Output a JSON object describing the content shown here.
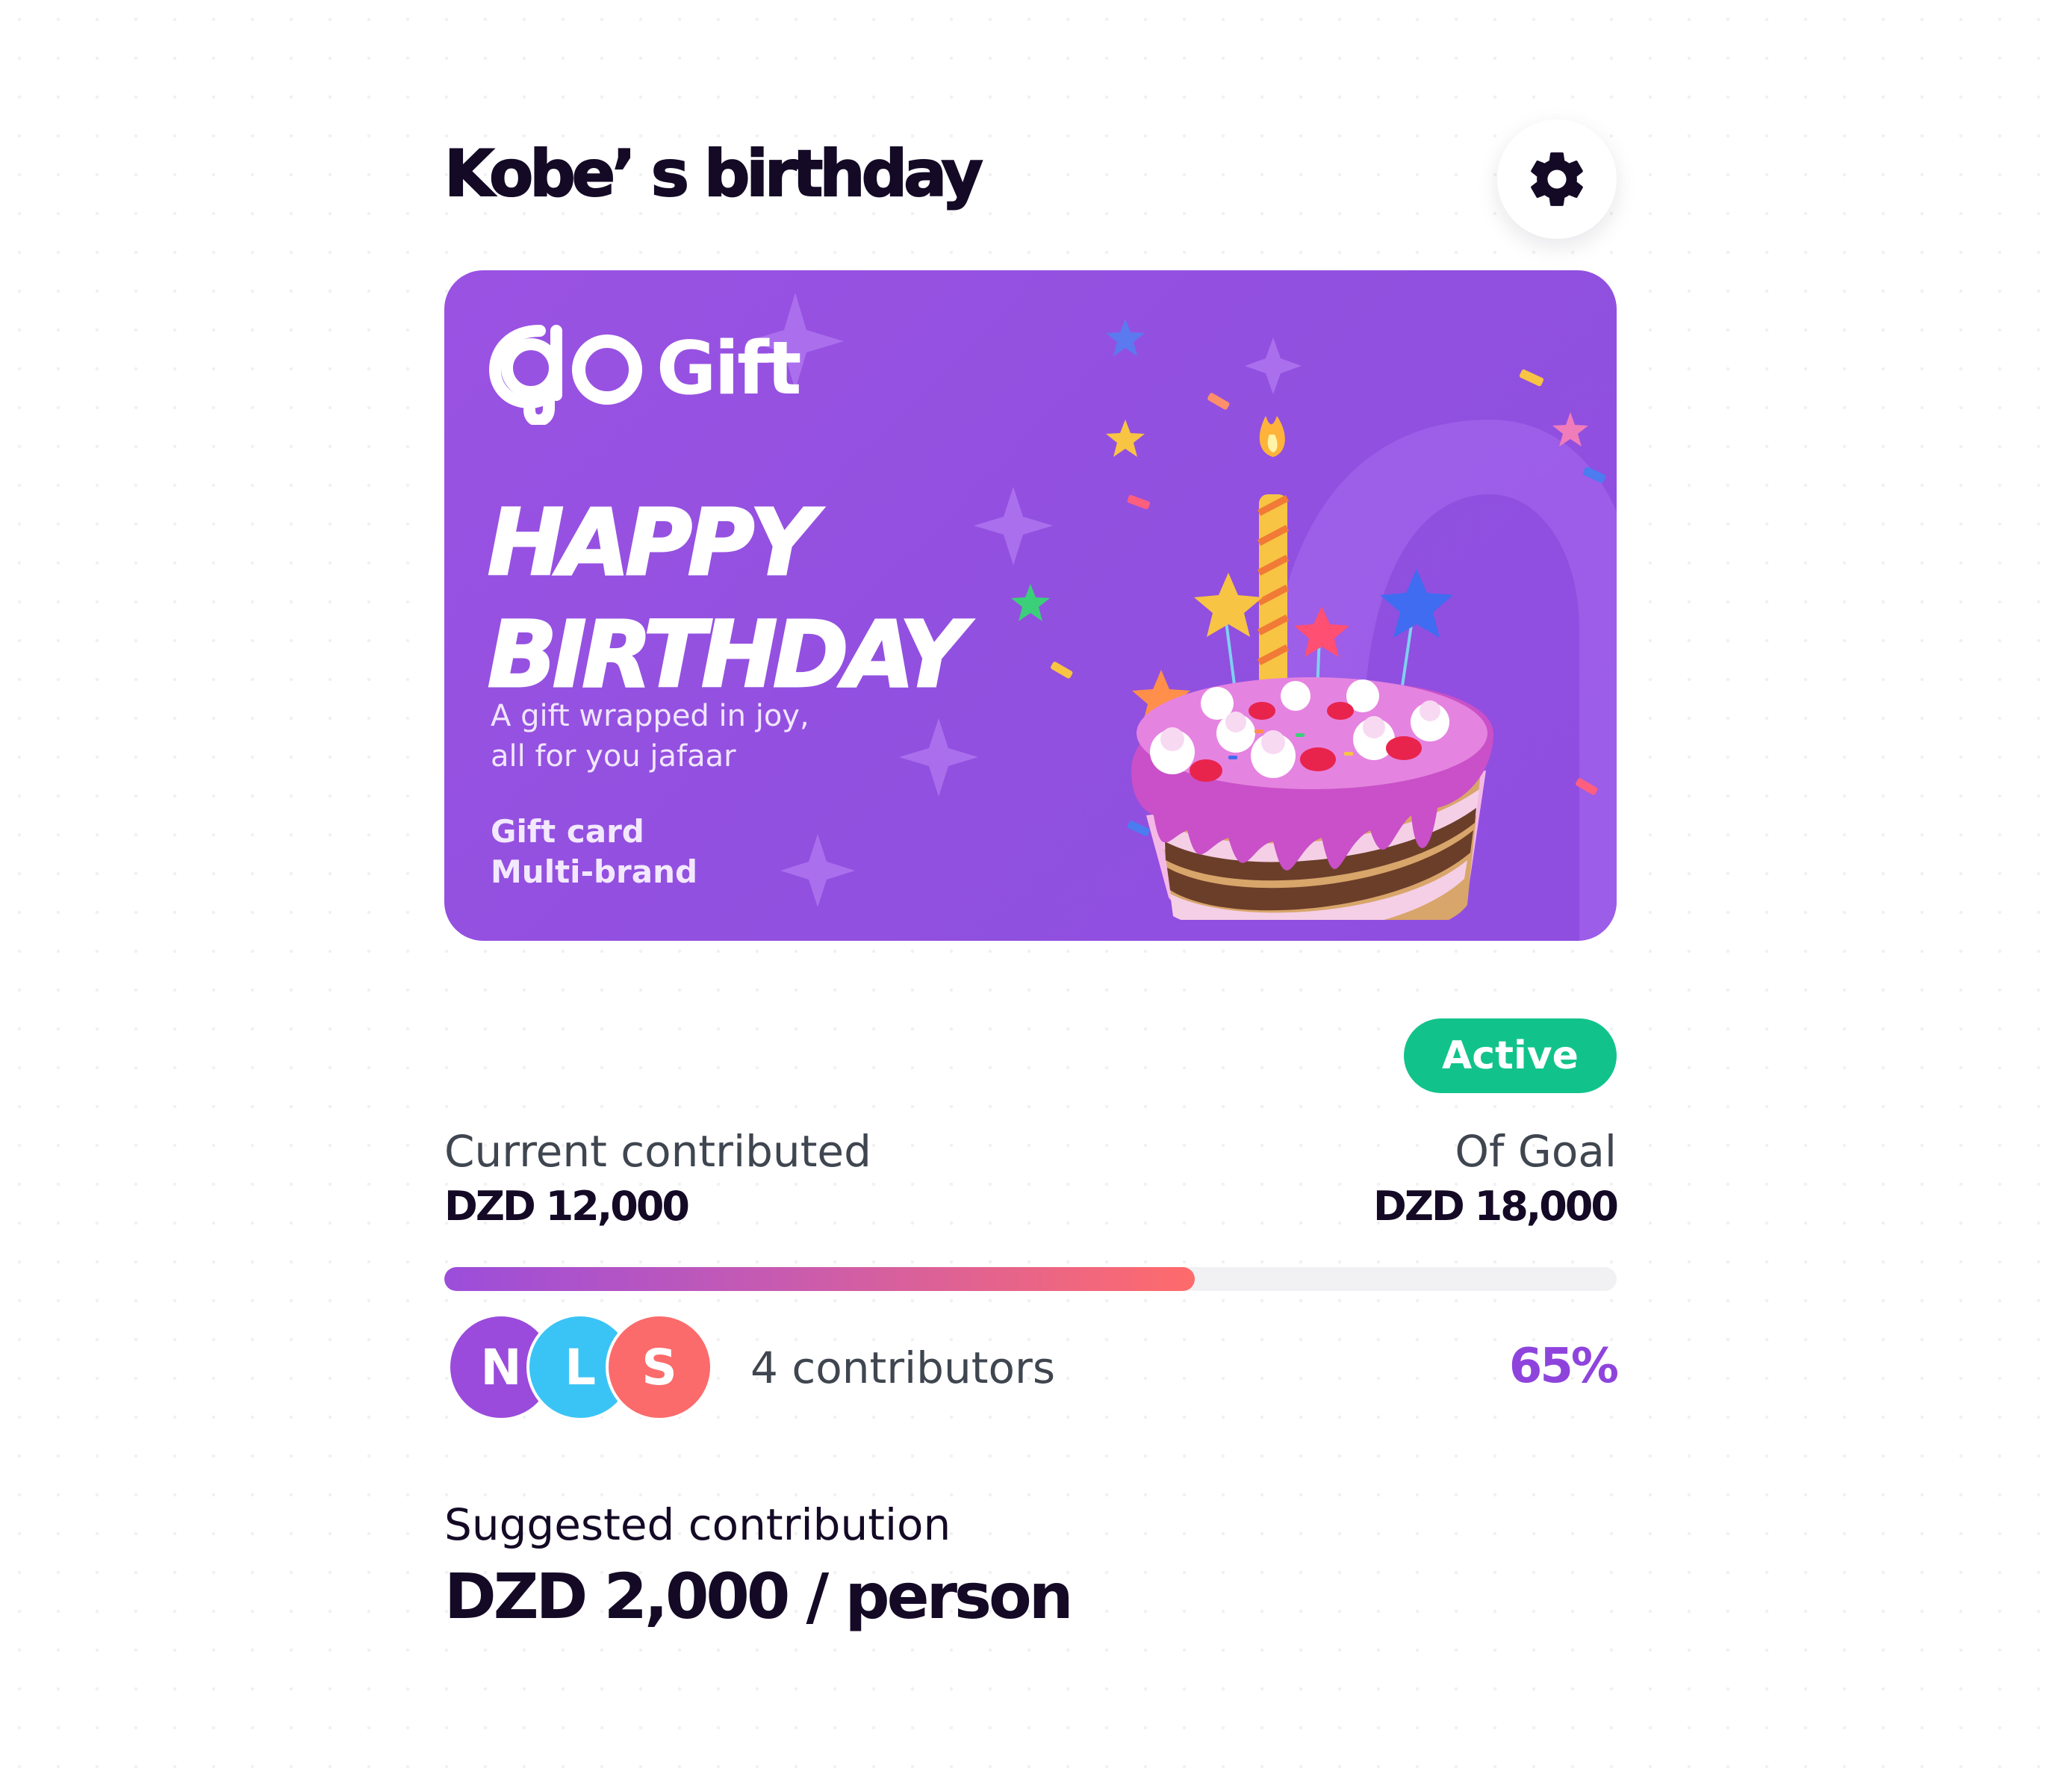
{
  "header": {
    "title": "Kobe’ s birthday",
    "settings_icon": "gear-icon"
  },
  "card": {
    "brand": "Gift",
    "brand_mark": "go-logo",
    "headline_line1": "HAPPY",
    "headline_line2": "BIRTHDAY",
    "tagline_line1": "A gift wrapped in joy,",
    "tagline_line2": "all for you jafaar",
    "type_line1": "Gift card",
    "type_line2": "Multi-brand",
    "illustration": "birthday-cake",
    "color": "#9a52e3"
  },
  "status": {
    "label": "Active",
    "color": "#11c38a"
  },
  "stats": {
    "current_label": "Current contributed",
    "current_value": "DZD 12,000",
    "goal_label": "Of Goal",
    "goal_value": "DZD 18,000"
  },
  "progress": {
    "fill_percent": 64,
    "percent_label": "65%"
  },
  "contributors": {
    "avatars": [
      {
        "initial": "N",
        "color": "#9a4bdc"
      },
      {
        "initial": "L",
        "color": "#3ac4f5"
      },
      {
        "initial": "S",
        "color": "#fb6b6b"
      }
    ],
    "count_label": "4 contributors"
  },
  "suggestion": {
    "label": "Suggested contribution",
    "value": "DZD 2,000 / person"
  }
}
